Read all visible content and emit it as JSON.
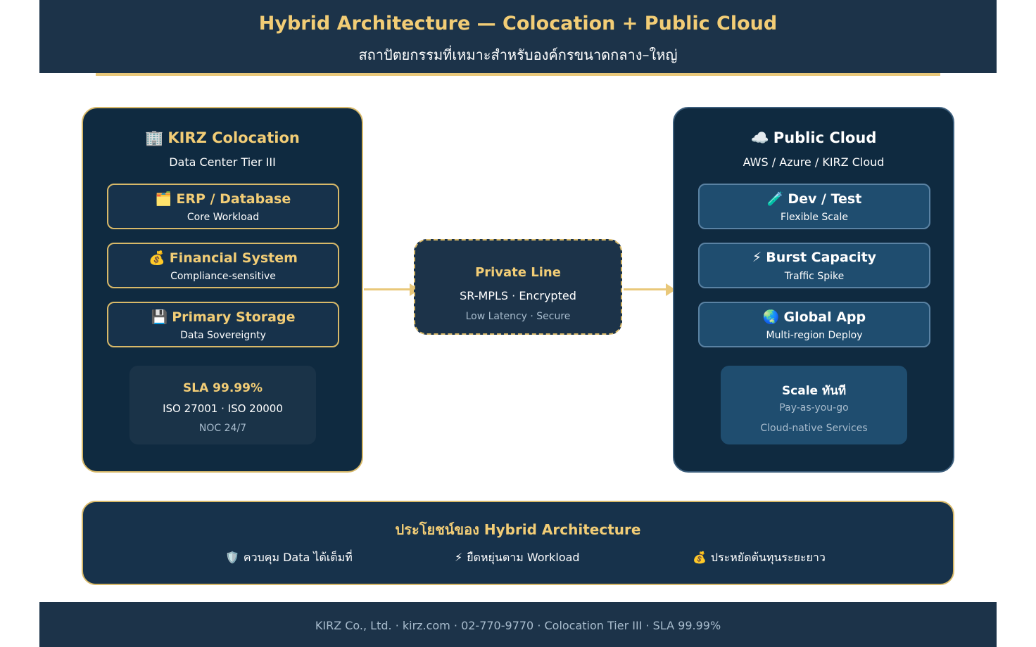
{
  "header": {
    "title": "Hybrid Architecture — Colocation + Public Cloud",
    "subtitle": "สถาปัตยกรรมที่เหมาะสำหรับองค์กรขนาดกลาง–ใหญ่"
  },
  "left_panel": {
    "icon": "🏢",
    "title": "KIRZ Colocation",
    "subtitle": "Data Center Tier III",
    "cards": [
      {
        "icon": "🗂️",
        "title": "ERP / Database",
        "subtitle": "Core Workload"
      },
      {
        "icon": "💰",
        "title": "Financial System",
        "subtitle": "Compliance-sensitive"
      },
      {
        "icon": "💾",
        "title": "Primary Storage",
        "subtitle": "Data Sovereignty"
      }
    ],
    "info": {
      "line1": "SLA 99.99%",
      "line2": "ISO 27001 · ISO 20000",
      "line3": "NOC 24/7"
    }
  },
  "private_line": {
    "title": "Private Line",
    "subtitle": "SR-MPLS · Encrypted",
    "note": "Low Latency · Secure"
  },
  "right_panel": {
    "icon": "☁️",
    "title": "Public Cloud",
    "subtitle": "AWS / Azure / KIRZ Cloud",
    "cards": [
      {
        "icon": "🧪",
        "title": "Dev / Test",
        "subtitle": "Flexible Scale"
      },
      {
        "icon": "⚡",
        "title": "Burst Capacity",
        "subtitle": "Traffic Spike"
      },
      {
        "icon": "🌏",
        "title": "Global App",
        "subtitle": "Multi-region Deploy"
      }
    ],
    "info": {
      "line1": "Scale ทันที",
      "line2": "Pay-as-you-go",
      "line3": "Cloud-native Services"
    }
  },
  "benefits": {
    "title": "ประโยชน์ของ Hybrid Architecture",
    "items": [
      {
        "icon": "🛡️",
        "label": "ควบคุม Data ได้เต็มที่"
      },
      {
        "icon": "⚡",
        "label": "ยืดหยุ่นตาม Workload"
      },
      {
        "icon": "💰",
        "label": "ประหยัดต้นทุนระยะยาว"
      }
    ]
  },
  "footer": {
    "text": "KIRZ Co., Ltd. · kirz.com · 02-770-9770 · Colocation Tier III · SLA 99.99%"
  }
}
